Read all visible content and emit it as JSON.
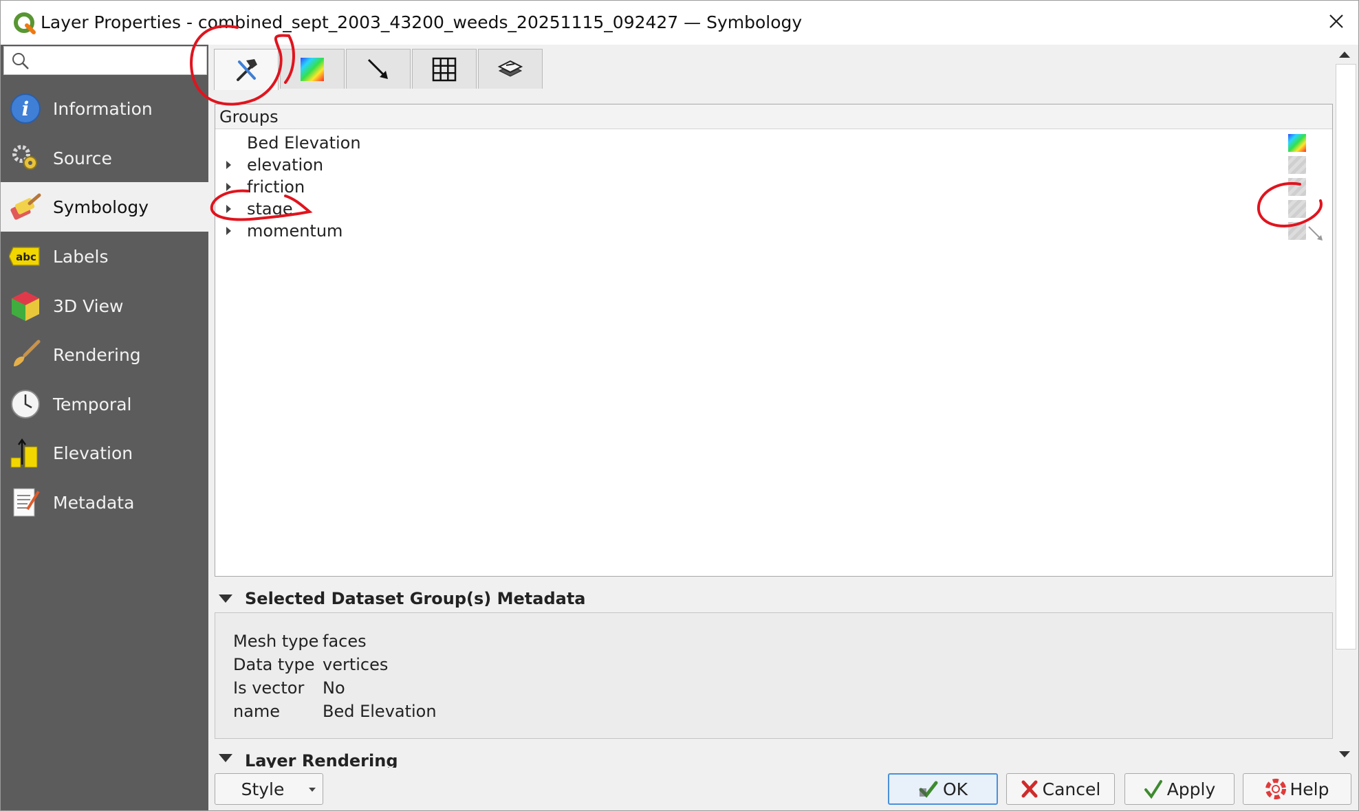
{
  "window": {
    "title": "Layer Properties - combined_sept_2003_43200_weeds_20251115_092427 — Symbology",
    "close_icon": "close-icon",
    "app_icon": "qgis-logo-icon"
  },
  "search": {
    "placeholder": "",
    "icon": "search-icon"
  },
  "sidebar": {
    "items": [
      {
        "label": "Information",
        "icon": "information-icon",
        "active": false
      },
      {
        "label": "Source",
        "icon": "source-gears-icon",
        "active": false
      },
      {
        "label": "Symbology",
        "icon": "symbology-brush-icon",
        "active": true
      },
      {
        "label": "Labels",
        "icon": "labels-abc-icon",
        "active": false
      },
      {
        "label": "3D View",
        "icon": "3d-cube-icon",
        "active": false
      },
      {
        "label": "Rendering",
        "icon": "rendering-brush-icon",
        "active": false
      },
      {
        "label": "Temporal",
        "icon": "clock-icon",
        "active": false
      },
      {
        "label": "Elevation",
        "icon": "elevation-icon",
        "active": false
      },
      {
        "label": "Metadata",
        "icon": "metadata-document-icon",
        "active": false
      }
    ]
  },
  "symbology_tabs": [
    {
      "icon": "hammer-wrench-icon",
      "active": true
    },
    {
      "icon": "color-ramp-icon",
      "active": false
    },
    {
      "icon": "vector-arrow-icon",
      "active": false
    },
    {
      "icon": "mesh-grid-icon",
      "active": false
    },
    {
      "icon": "layer-stack-icon",
      "active": false
    }
  ],
  "groups": {
    "header": "Groups",
    "items": [
      {
        "label": "Bed Elevation",
        "expandable": false,
        "swatch": "rainbow"
      },
      {
        "label": "elevation",
        "expandable": true,
        "swatch": "gray"
      },
      {
        "label": "friction",
        "expandable": true,
        "swatch": "gray"
      },
      {
        "label": "stage",
        "expandable": true,
        "swatch": "gray"
      },
      {
        "label": "momentum",
        "expandable": true,
        "swatch": "gray"
      }
    ]
  },
  "metadata_section": {
    "title": "Selected Dataset Group(s) Metadata",
    "rows": [
      {
        "key": "Mesh type",
        "value": "faces"
      },
      {
        "key": "Data type",
        "value": "vertices"
      },
      {
        "key": "Is vector",
        "value": "No"
      },
      {
        "key": "name",
        "value": "Bed Elevation"
      }
    ]
  },
  "rendering_section": {
    "title": "Layer Rendering"
  },
  "buttons": {
    "style": "Style",
    "ok": "OK",
    "cancel": "Cancel",
    "apply": "Apply",
    "help": "Help"
  },
  "colors": {
    "sidebar_bg": "#5c5c5c",
    "annotation_red": "#e0141e",
    "ok_border": "#4a90d9"
  }
}
